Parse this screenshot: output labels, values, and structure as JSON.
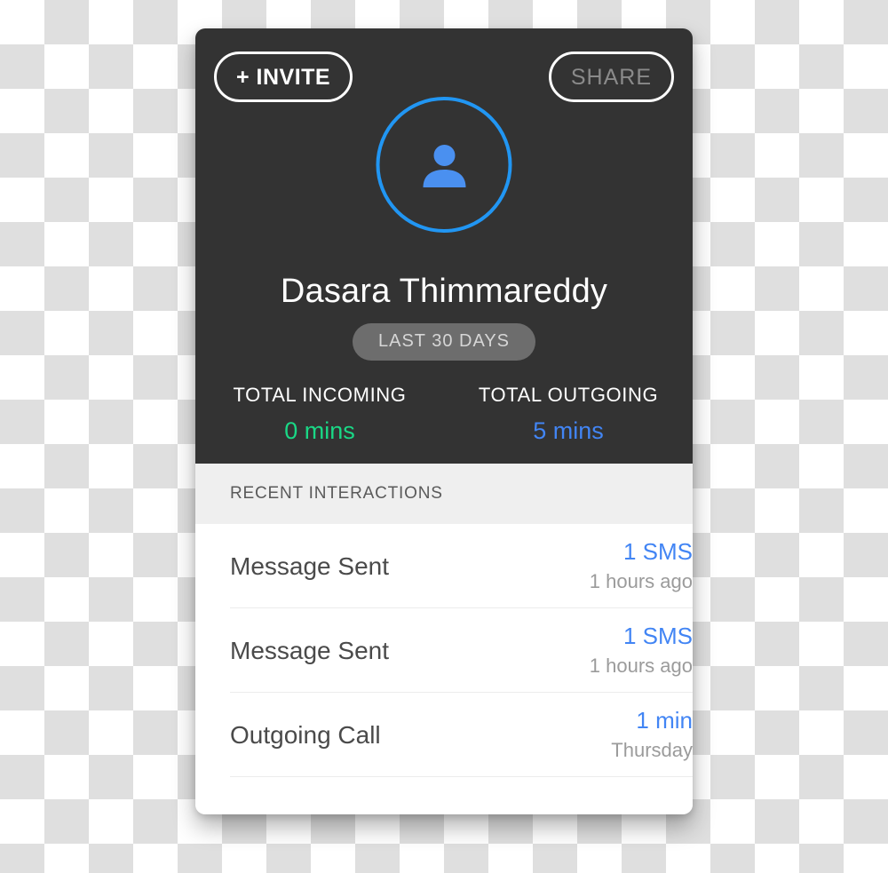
{
  "card": {
    "header": {
      "invite_button": "+ INVITE",
      "share_button": "SHARE",
      "avatar_icon": "person-icon",
      "display_name": "Dasara Thimmareddy",
      "range_badge": "LAST 30 DAYS",
      "stats": [
        {
          "label": "TOTAL INCOMING",
          "value": "0 mins",
          "color": "#1ad886"
        },
        {
          "label": "TOTAL OUTGOING",
          "value": "5 mins",
          "color": "#4285f4"
        }
      ]
    },
    "section": {
      "title": "RECENT INTERACTIONS"
    },
    "interactions": [
      {
        "title": "Message Sent",
        "count": "1 SMS",
        "time": "1 hours ago"
      },
      {
        "title": "Message Sent",
        "count": "1 SMS",
        "time": "1 hours ago"
      },
      {
        "title": "Outgoing Call",
        "count": "1 min",
        "time": "Thursday"
      }
    ]
  },
  "colors": {
    "card_dark": "#333333",
    "accent_blue": "#4285f4",
    "ring_blue": "#2196f3",
    "accent_green": "#1ad886",
    "section_bg": "#efefef"
  }
}
